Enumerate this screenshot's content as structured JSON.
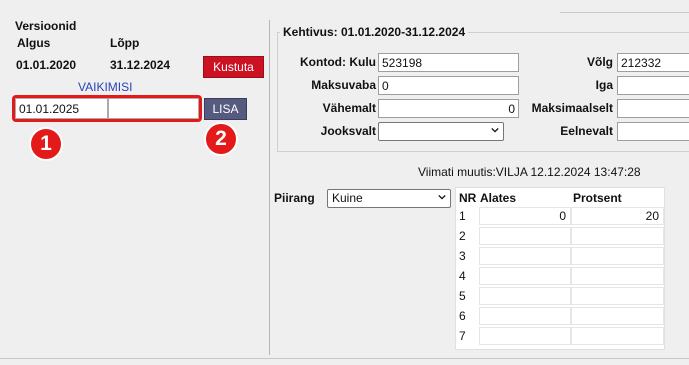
{
  "versions": {
    "title": "Versioonid",
    "col_start": "Algus",
    "col_end": "Lõpp",
    "row_start": "01.01.2020",
    "row_end": "31.12.2024",
    "delete_label": "Kustuta",
    "default_label": "VAIKIMISI",
    "new_start_value": "01.01.2025",
    "new_end_value": "",
    "add_label": "LISA",
    "callout_1": "1",
    "callout_2": "2"
  },
  "validity": {
    "legend": "Kehtivus: 01.01.2020-31.12.2024",
    "accounts_label": "Kontod: Kulu",
    "accounts_value": "523198",
    "debt_label": "Võlg",
    "debt_value": "212332",
    "maksuvaba_label": "Maksuvaba",
    "maksuvaba_value": "0",
    "iga_label": "Iga",
    "iga_value": "",
    "vahemalt_label": "Vähemalt",
    "vahemalt_value": "0",
    "maksimaalselt_label": "Maksimaalselt",
    "maksimaalselt_value": "",
    "jooksvalt_label": "Jooksvalt",
    "jooksvalt_value": "",
    "eelnevalt_label": "Eelnevalt",
    "eelnevalt_value": ""
  },
  "modified": "Viimati muutis:VILJA 12.12.2024 13:47:28",
  "limit": {
    "label": "Piirang",
    "value": "Kuine"
  },
  "table": {
    "headers": [
      "NR",
      "Alates",
      "Protsent"
    ],
    "rows": [
      {
        "nr": "1",
        "alates": "0",
        "protsent": "20"
      },
      {
        "nr": "2",
        "alates": "",
        "protsent": ""
      },
      {
        "nr": "3",
        "alates": "",
        "protsent": ""
      },
      {
        "nr": "4",
        "alates": "",
        "protsent": ""
      },
      {
        "nr": "5",
        "alates": "",
        "protsent": ""
      },
      {
        "nr": "6",
        "alates": "",
        "protsent": ""
      },
      {
        "nr": "7",
        "alates": "",
        "protsent": ""
      }
    ]
  },
  "colors": {
    "delete_button": "#cc1122",
    "add_button": "#565a7e",
    "callout": "#e41a1a",
    "default_link": "#2a43b8"
  },
  "icons": [
    "chevron-down-icon"
  ]
}
